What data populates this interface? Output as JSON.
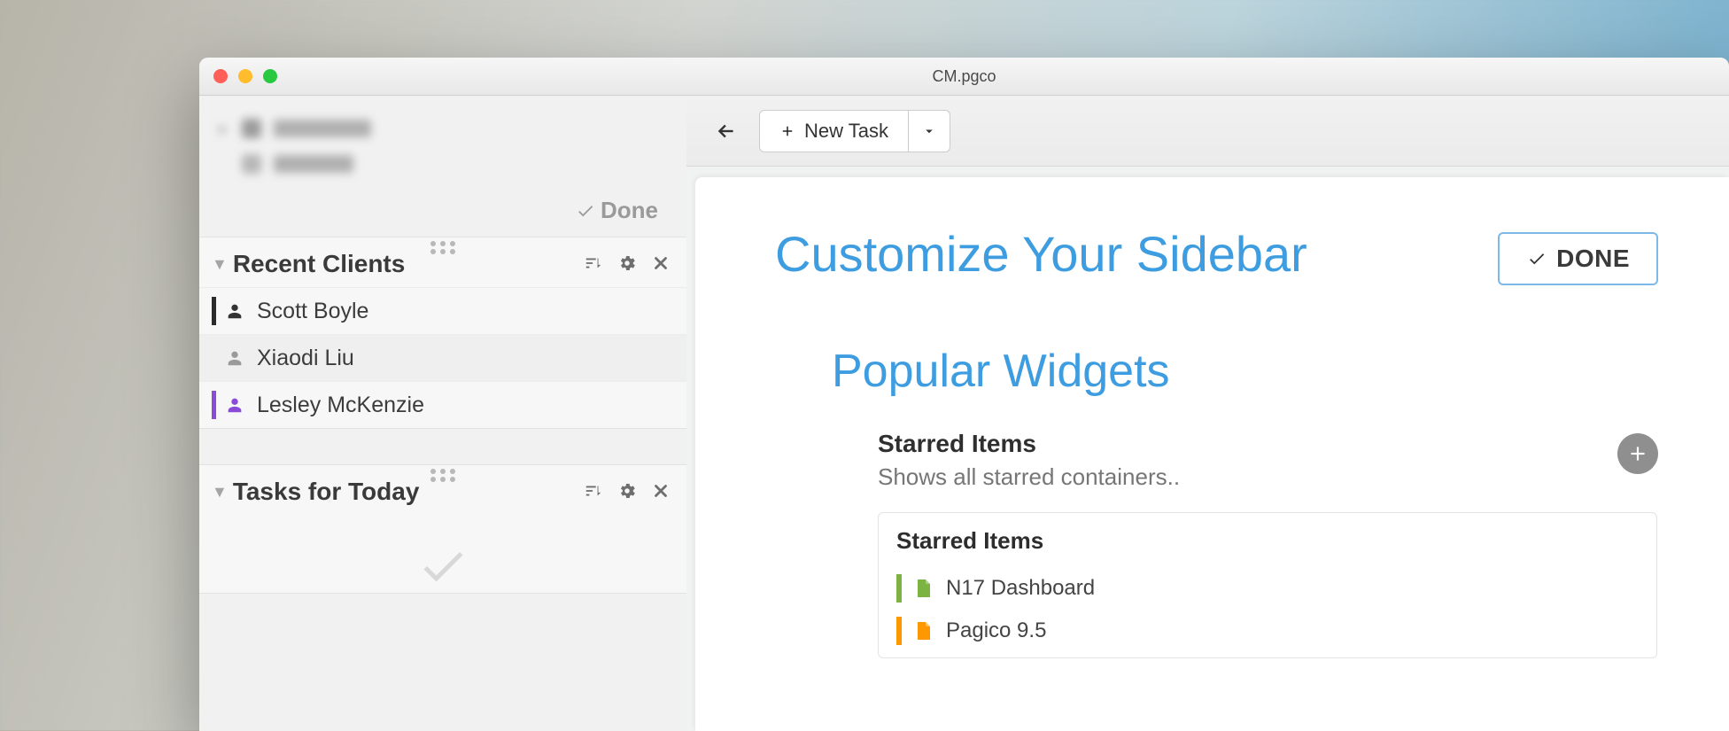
{
  "window": {
    "title": "CM.pgco"
  },
  "toolbar": {
    "new_task": "New Task"
  },
  "sidebar": {
    "done_label": "Done",
    "widgets": [
      {
        "title": "Recent Clients",
        "items": [
          {
            "name": "Scott Boyle",
            "accent": "black"
          },
          {
            "name": "Xiaodi Liu",
            "accent": "none"
          },
          {
            "name": "Lesley McKenzie",
            "accent": "purple"
          }
        ]
      },
      {
        "title": "Tasks for Today",
        "items": []
      }
    ]
  },
  "main": {
    "title": "Customize Your Sidebar",
    "done_button": "DONE",
    "section_title": "Popular Widgets",
    "starred": {
      "name": "Starred Items",
      "desc": "Shows all starred containers..",
      "preview_title": "Starred Items",
      "preview_items": [
        {
          "label": "N17 Dashboard",
          "color": "green"
        },
        {
          "label": "Pagico 9.5",
          "color": "orange"
        }
      ]
    }
  }
}
